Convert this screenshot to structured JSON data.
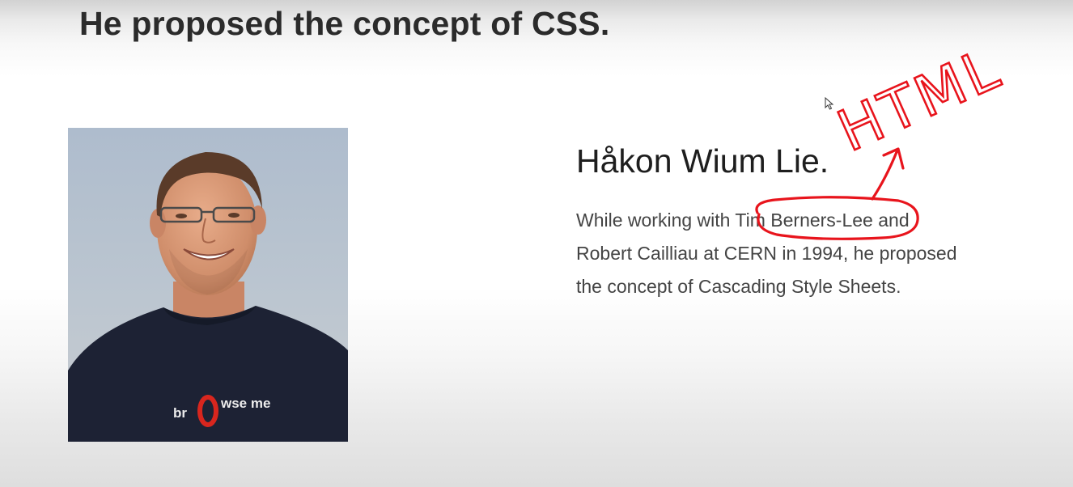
{
  "slide": {
    "title": "He proposed the concept of CSS."
  },
  "profile": {
    "name": "Håkon Wium Lie.",
    "bio": {
      "before_highlight": "While working with ",
      "highlight": "Tim Berners-Lee",
      "after_highlight": " and Robert Cailliau at CERN in 1994, he proposed the concept of Cascading Style Sheets."
    },
    "photo": {
      "icon": "portrait-photo",
      "shirt_text_left": "br",
      "shirt_text_right": "wse me"
    }
  },
  "annotation": {
    "handwritten_text": "HTML",
    "color": "#e8141c"
  },
  "cursor": {
    "icon": "mouse-pointer-icon"
  }
}
